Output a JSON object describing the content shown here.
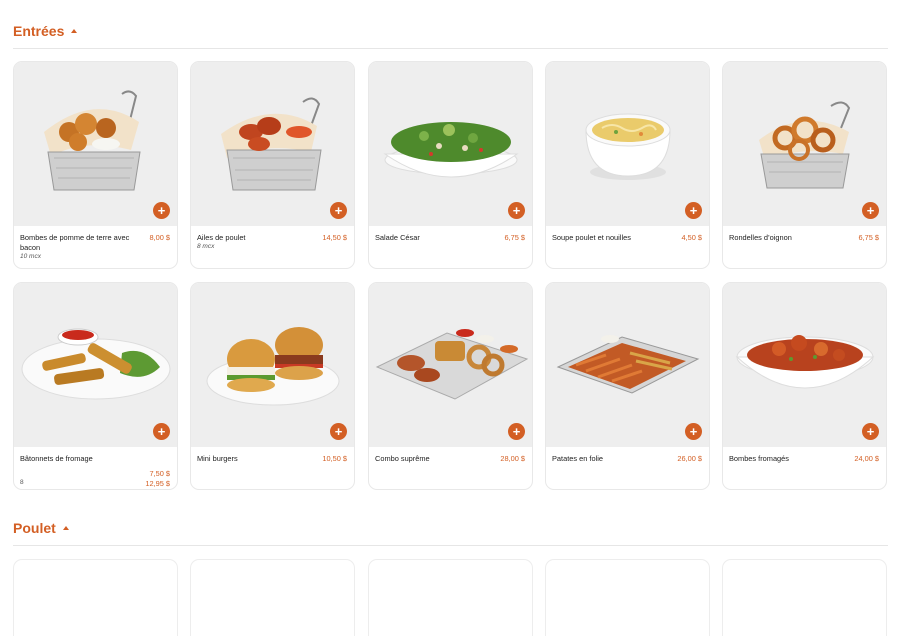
{
  "sections": [
    {
      "title": "Entrées",
      "items": [
        {
          "name": "Bombes de pomme de terre avec bacon",
          "price": "8,00 $",
          "note": "10 mcx",
          "image": "basket-of-potato-bombs"
        },
        {
          "name": "Ailes de poulet",
          "price": "14,50 $",
          "note": "8 mcx",
          "image": "basket-of-chicken-wings"
        },
        {
          "name": "Salade César",
          "price": "6,75 $",
          "note": "",
          "image": "caesar-salad-bowl"
        },
        {
          "name": "Soupe poulet et nouilles",
          "price": "4,50 $",
          "note": "",
          "image": "chicken-noodle-soup-bowl"
        },
        {
          "name": "Rondelles d’oignon",
          "price": "6,75 $",
          "note": "",
          "image": "basket-of-onion-rings"
        },
        {
          "name": "Bâtonnets de fromage",
          "price": "",
          "note": "8",
          "prices": [
            "7,50 $",
            "12,95 $"
          ],
          "image": "cheese-sticks-plate"
        },
        {
          "name": "Mini burgers",
          "price": "10,50 $",
          "note": "",
          "image": "mini-burgers-plate"
        },
        {
          "name": "Combo suprême",
          "price": "28,00 $",
          "note": "",
          "image": "combo-platter"
        },
        {
          "name": "Patates en folie",
          "price": "26,00 $",
          "note": "",
          "image": "loaded-fries-tray"
        },
        {
          "name": "Bombes fromagés",
          "price": "24,00 $",
          "note": "",
          "image": "cheese-bombs-bowl"
        }
      ]
    },
    {
      "title": "Poulet",
      "items": []
    }
  ],
  "add_symbol": "+",
  "colors": {
    "accent": "#d35f24",
    "image_bg": "#eeeeee",
    "border": "#e8e8e8"
  }
}
